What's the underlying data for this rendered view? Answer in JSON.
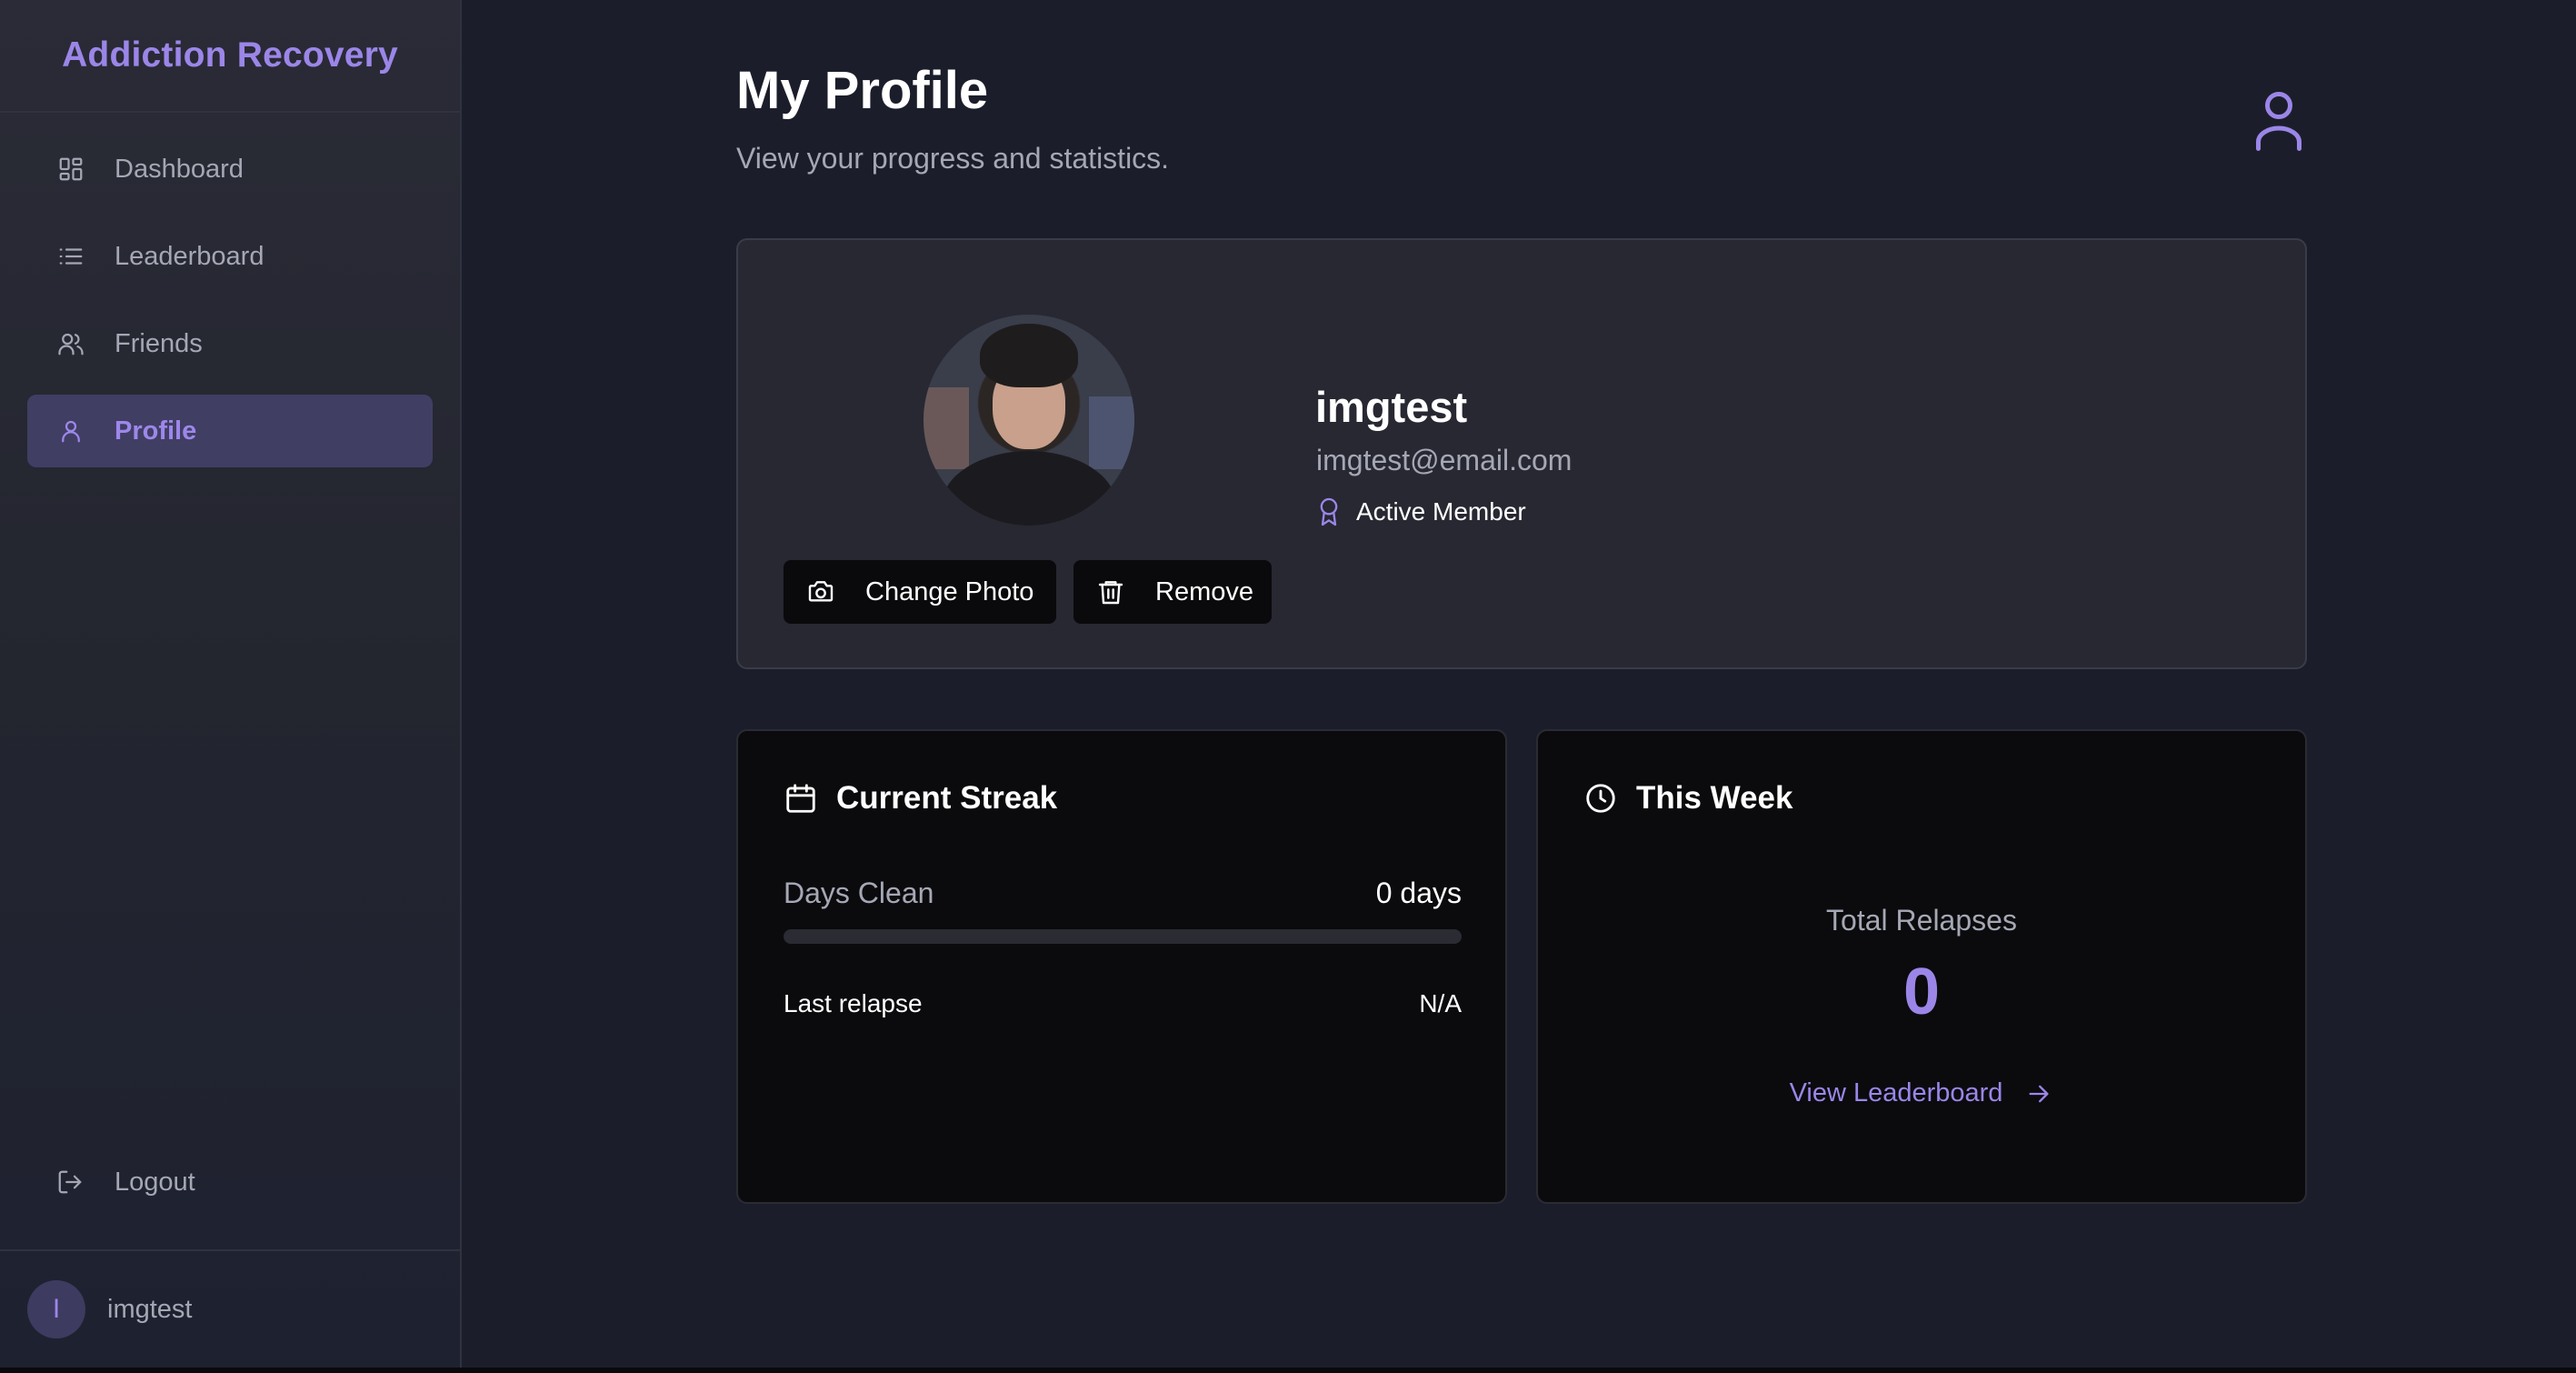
{
  "app": {
    "brand": "Addiction Recovery"
  },
  "sidebar": {
    "items": [
      {
        "label": "Dashboard",
        "icon": "dashboard-icon",
        "active": false
      },
      {
        "label": "Leaderboard",
        "icon": "list-icon",
        "active": false
      },
      {
        "label": "Friends",
        "icon": "users-icon",
        "active": false
      },
      {
        "label": "Profile",
        "icon": "user-icon",
        "active": true
      }
    ],
    "logout_label": "Logout",
    "user": {
      "initial": "I",
      "name": "imgtest"
    }
  },
  "header": {
    "title": "My Profile",
    "subtitle": "View your progress and statistics.",
    "icon": "user-icon"
  },
  "profile": {
    "username": "imgtest",
    "email": "imgtest@email.com",
    "badge": "Active Member",
    "change_photo_label": "Change Photo",
    "remove_label": "Remove"
  },
  "streak": {
    "title": "Current Streak",
    "days_label": "Days Clean",
    "days_value": "0 days",
    "progress_fraction": 0,
    "last_relapse_label": "Last relapse",
    "last_relapse_value": "N/A"
  },
  "week": {
    "title": "This Week",
    "total_label": "Total Relapses",
    "total_value": "0",
    "link_label": "View Leaderboard"
  },
  "colors": {
    "accent": "#9b86e8",
    "background": "#1b1e2a",
    "card": "#272832",
    "stat_card": "#0b0b0e",
    "active_nav": "#413e64"
  }
}
